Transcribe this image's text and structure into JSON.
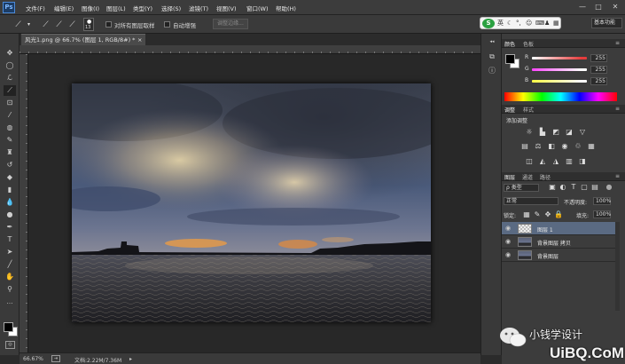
{
  "app": {
    "logo": "Ps"
  },
  "menu": [
    "文件(F)",
    "编辑(E)",
    "图像(I)",
    "图层(L)",
    "类型(Y)",
    "选择(S)",
    "滤镜(T)",
    "视图(V)",
    "窗口(W)",
    "帮助(H)"
  ],
  "window_controls": {
    "minimize": "—",
    "restore": "□",
    "close": "✕"
  },
  "options": {
    "brush_size": "13",
    "sample_all_label": "对所有图层取样",
    "auto_enhance_label": "自动增强",
    "refine_edge_label": "调整边缘...",
    "workspace": "基本功能"
  },
  "ime": {
    "logo": "S",
    "lang": "英"
  },
  "document": {
    "tab_title": "风光1.png @ 66.7% (图层 1, RGB/8#) *",
    "close_symbol": "×"
  },
  "status": {
    "zoom": "66.67%",
    "doc_size": "文档:2.22M/7.36M"
  },
  "color_panel": {
    "tabs": [
      "颜色",
      "色板"
    ],
    "rows": [
      {
        "label": "R",
        "value": "255",
        "color": "#e53b3b"
      },
      {
        "label": "G",
        "value": "255",
        "color": "#3be84a"
      },
      {
        "label": "B",
        "value": "255",
        "color": "#4a5cff"
      }
    ]
  },
  "adjust_panel": {
    "tabs": [
      "调整",
      "样式"
    ],
    "title": "添加调整"
  },
  "layers_panel": {
    "tabs": [
      "图层",
      "通道",
      "路径"
    ],
    "filter_label": "ρ 类型",
    "blend_mode": "正常",
    "opacity_label": "不透明度:",
    "opacity_value": "100%",
    "lock_label": "锁定:",
    "fill_label": "填充:",
    "fill_value": "100%",
    "layers": [
      {
        "name": "图层 1",
        "selected": true
      },
      {
        "name": "背景图层 拷贝",
        "selected": false
      },
      {
        "name": "背景图层",
        "selected": false
      }
    ]
  },
  "watermark": {
    "account": "小钱学设计",
    "site": "UiBQ.CoM"
  }
}
